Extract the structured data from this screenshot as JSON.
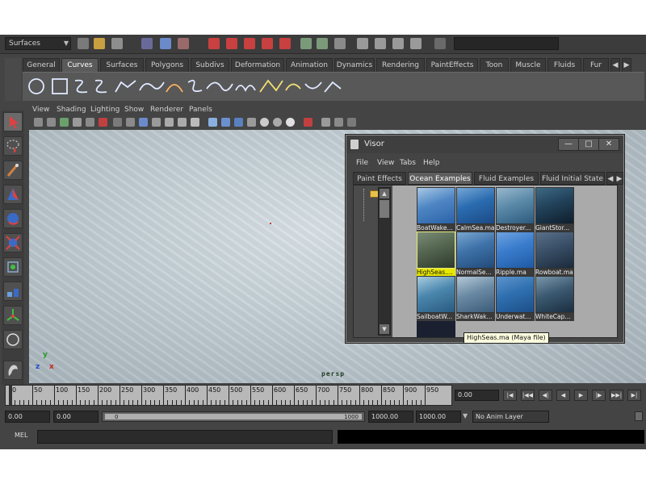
{
  "status_line": {
    "menu_set": "Surfaces"
  },
  "shelf": {
    "tabs": [
      "General",
      "Curves",
      "Surfaces",
      "Polygons",
      "Subdivs",
      "Deformation",
      "Animation",
      "Dynamics",
      "Rendering",
      "PaintEffects",
      "Toon",
      "Muscle",
      "Fluids",
      "Fur"
    ],
    "active_tab": "Curves",
    "icons": [
      "circle-curve-icon",
      "square-curve-icon",
      "cv-curve-icon",
      "ep-curve-icon",
      "pencil-curve-icon",
      "arc-curve-icon",
      "arc-2pt-icon",
      "text-curve-icon",
      "bezier-curve-icon",
      "wave-curve-icon",
      "attach-curves-icon",
      "detach-curves-icon",
      "rebuild-curve-icon",
      "offset-curve-icon"
    ]
  },
  "panel": {
    "menus": [
      "View",
      "Shading",
      "Lighting",
      "Show",
      "Renderer",
      "Panels"
    ],
    "camera_label": "persp",
    "axis": {
      "x": "x",
      "y": "y",
      "z": "z"
    }
  },
  "visor": {
    "title": "Visor",
    "controls": {
      "minimize": "—",
      "maximize": "□",
      "close": "✕"
    },
    "menus": [
      "File",
      "View",
      "Tabs",
      "Help"
    ],
    "tabs": [
      "Paint Effects",
      "Ocean Examples",
      "Fluid Examples",
      "Fluid Initial State"
    ],
    "active_tab": "Ocean Examples",
    "thumbnails": [
      {
        "label": "BoatWake...",
        "colors": [
          "#2a62a8",
          "#4e86c4",
          "#a8c8e4"
        ]
      },
      {
        "label": "CalmSea.ma",
        "colors": [
          "#1c4a86",
          "#2a6cb0",
          "#76a6d6"
        ]
      },
      {
        "label": "Destroyer...",
        "colors": [
          "#2c5a7e",
          "#5b8aa8",
          "#9ab8ce"
        ]
      },
      {
        "label": "GiantStor...",
        "colors": [
          "#0e1e2c",
          "#22425a",
          "#3e6a84"
        ]
      },
      {
        "label": "HighSeas....",
        "colors": [
          "#2e3a2c",
          "#546650",
          "#7a8c76"
        ],
        "selected": true
      },
      {
        "label": "NormalSe...",
        "colors": [
          "#224a7a",
          "#3e72a8",
          "#7aa6d0"
        ]
      },
      {
        "label": "Ripple.ma",
        "colors": [
          "#1e5aa4",
          "#3a7ccc",
          "#6ea2e0"
        ]
      },
      {
        "label": "Rowboat.ma",
        "colors": [
          "#1a2a3a",
          "#3a5068",
          "#5a7088"
        ]
      },
      {
        "label": "SailboatW...",
        "colors": [
          "#2a5a80",
          "#4a86ac",
          "#a8cce0"
        ]
      },
      {
        "label": "SharkWak...",
        "colors": [
          "#3a5a78",
          "#6a8aa4",
          "#b4c8d6"
        ]
      },
      {
        "label": "Underwat...",
        "colors": [
          "#1c4e88",
          "#3070b0",
          "#5c94cc"
        ]
      },
      {
        "label": "WhiteCap...",
        "colors": [
          "#1a2e40",
          "#3c5a72",
          "#7a96aa"
        ]
      }
    ],
    "tooltip": "HighSeas.ma (Maya file)"
  },
  "timeline": {
    "ticks": [
      "0",
      "50",
      "100",
      "150",
      "200",
      "250",
      "300",
      "350",
      "400",
      "450",
      "500",
      "550",
      "600",
      "650",
      "700",
      "750",
      "800",
      "850",
      "900",
      "950"
    ],
    "current_frame": "0.00",
    "playback_buttons": [
      "|◀",
      "|◀◀",
      "◀|",
      "◀",
      "▶",
      "|▶",
      "▶▶|",
      "▶|"
    ]
  },
  "range": {
    "start_time": "0.00",
    "playback_start": "0.00",
    "range_start_label": "0",
    "range_end_label": "1000",
    "playback_end": "1000.00",
    "end_time": "1000.00",
    "anim_layer": "No Anim Layer"
  },
  "command_line": {
    "label": "MEL"
  }
}
